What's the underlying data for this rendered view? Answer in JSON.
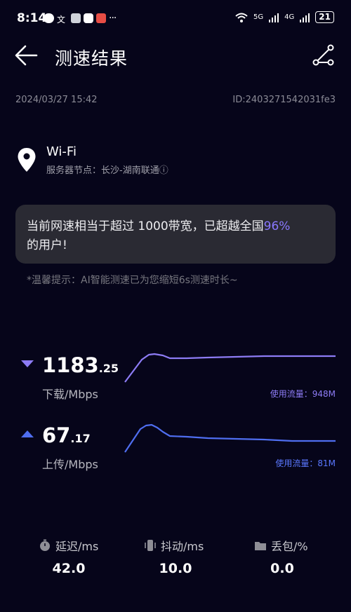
{
  "status_bar": {
    "time": "8:14",
    "net1": "6",
    "net2": "5G",
    "net3": "4G",
    "battery": "21"
  },
  "header": {
    "title": "测速结果"
  },
  "meta": {
    "datetime": "2024/03/27 15:42",
    "id": "ID:2403271542031fe3"
  },
  "server": {
    "name": "Wi-Fi",
    "node": "服务器节点：长沙-湖南联通ⓘ"
  },
  "banner": {
    "text_before": "当前网速相当于超过 1000带宽，已超越全国",
    "percent": "96%",
    "text_after": "的用户!"
  },
  "hint": "*温馨提示：AI智能测速已为您缩短6s测速时长~",
  "download": {
    "value_int": "1183",
    "value_dec": ".25",
    "label": "下载/Mbps",
    "traffic": "使用流量：948M",
    "color": "#8d7cf5"
  },
  "upload": {
    "value_int": "67",
    "value_dec": ".17",
    "label": "上传/Mbps",
    "traffic": "使用流量：81M",
    "color": "#4f6ef0"
  },
  "metrics": {
    "latency_label": "延迟/ms",
    "latency_value": "42.0",
    "jitter_label": "抖动/ms",
    "jitter_value": "10.0",
    "loss_label": "丢包/%",
    "loss_value": "0.0"
  },
  "icons": {
    "back": "arrow-left-icon",
    "share": "share-icon",
    "location": "location-pin-icon",
    "latency": "stopwatch-icon",
    "jitter": "vibration-icon",
    "loss": "folder-icon"
  }
}
